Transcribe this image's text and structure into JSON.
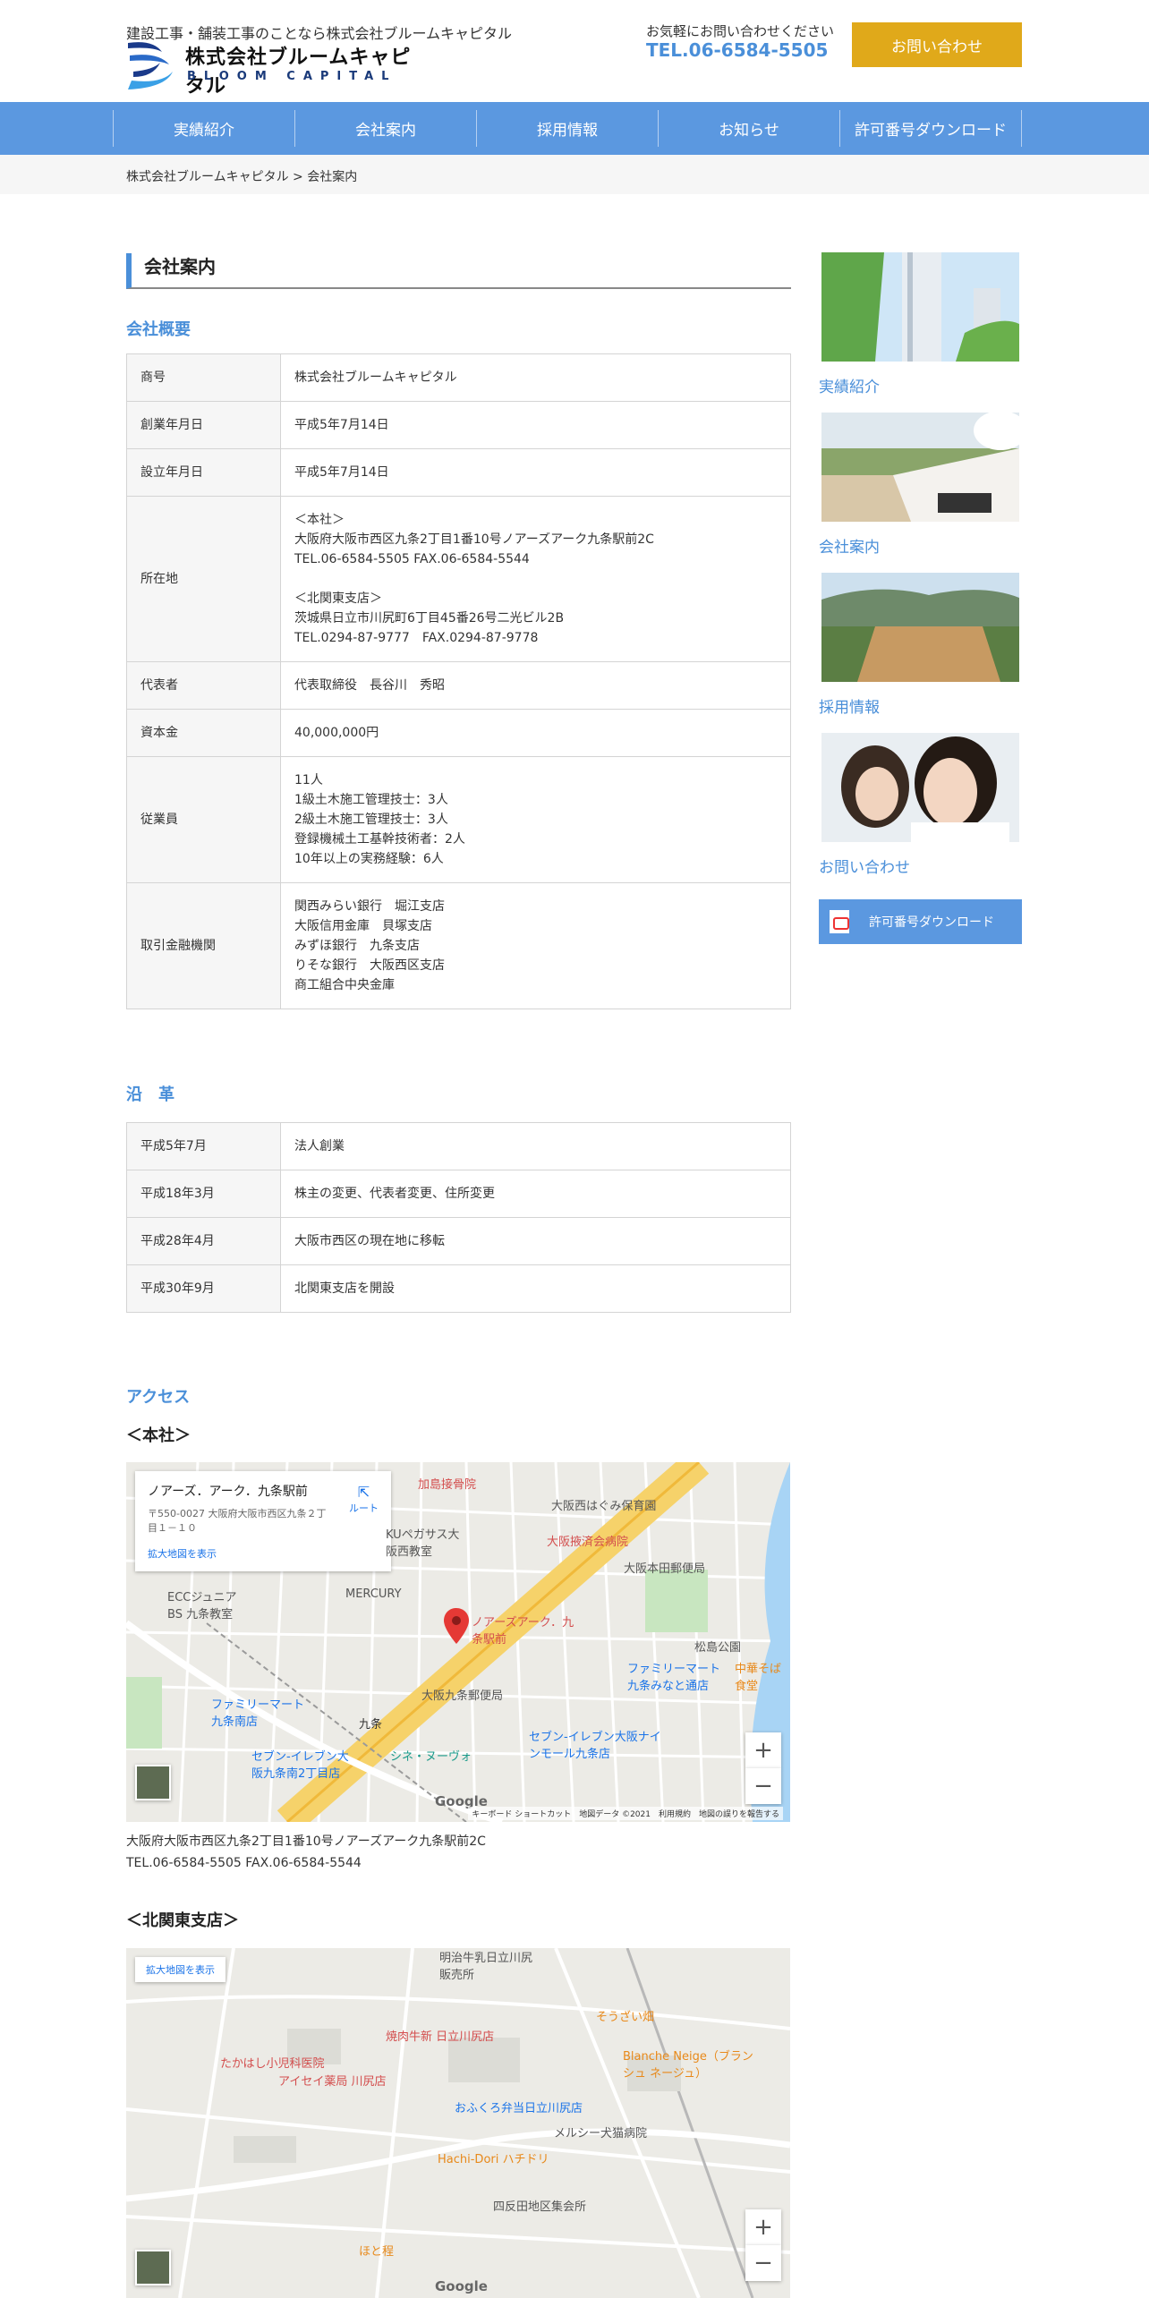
{
  "header": {
    "tagline": "建設工事・舗装工事のことなら株式会社ブルームキャピタル",
    "logo_name": "株式会社ブルームキャピタル",
    "logo_sub": "BLOOM CAPITAL",
    "contact_note": "お気軽にお問い合わせください",
    "tel": "TEL.06-6584-5505",
    "contact_button": "お問い合わせ"
  },
  "nav": {
    "items": [
      "実績紹介",
      "会社案内",
      "採用情報",
      "お知らせ",
      "許可番号ダウンロード"
    ]
  },
  "breadcrumb": "株式会社ブルームキャピタル > 会社案内",
  "page_title": "会社案内",
  "overview": {
    "title": "会社概要",
    "rows": [
      {
        "label": "商号",
        "value": "株式会社ブルームキャピタル"
      },
      {
        "label": "創業年月日",
        "value": "平成5年7月14日"
      },
      {
        "label": "設立年月日",
        "value": "平成5年7月14日"
      },
      {
        "label": "所在地",
        "value": "＜本社＞\n大阪府大阪市西区九条2丁目1番10号ノアーズアーク九条駅前2C\nTEL.06-6584-5505 FAX.06-6584-5544\n\n＜北関東支店＞\n茨城県日立市川尻町6丁目45番26号二光ビル2B\nTEL.0294-87-9777　FAX.0294-87-9778"
      },
      {
        "label": "代表者",
        "value": "代表取締役　長谷川　秀昭"
      },
      {
        "label": "資本金",
        "value": "40,000,000円"
      },
      {
        "label": "従業員",
        "value": "11人\n1級土木施工管理技士：3人\n2級土木施工管理技士：3人\n登録機械土工基幹技術者：2人\n10年以上の実務経験：6人"
      },
      {
        "label": "取引金融機関",
        "value": "関西みらい銀行　堀江支店\n大阪信用金庫　貝塚支店\nみずほ銀行　九条支店\nりそな銀行　大阪西区支店\n商工組合中央金庫"
      }
    ]
  },
  "history": {
    "title": "沿　革",
    "rows": [
      {
        "label": "平成5年7月",
        "value": "法人創業"
      },
      {
        "label": "平成18年3月",
        "value": "株主の変更、代表者変更、住所変更"
      },
      {
        "label": "平成28年4月",
        "value": "大阪市西区の現在地に移転"
      },
      {
        "label": "平成30年9月",
        "value": "北関東支店を開設"
      }
    ]
  },
  "access": {
    "title": "アクセス",
    "head_office_heading": "＜本社＞",
    "head_office_address": "大阪府大阪市西区九条2丁目1番10号ノアーズアーク九条駅前2C",
    "head_office_tel": "TEL.06-6584-5505 FAX.06-6584-5544",
    "branch_heading": "＜北関東支店＞"
  },
  "map1": {
    "card_title": "ノアーズ．アーク．九条駅前",
    "card_address": "〒550-0027 大阪府大阪市西区九条２丁目１－１０",
    "card_link": "拡大地図を表示",
    "card_route": "ルート",
    "footer": "キーボード ショートカット　地図データ ©2021　利用規約　地図の誤りを報告する",
    "google": "Google",
    "labels": [
      "加島接骨院",
      "大阪西はぐみ保育園",
      "KUペガサス大阪西教室",
      "大阪掖済会病院",
      "大阪本田郵便局",
      "ECCジュニアBS 九条教室",
      "MERCURY",
      "ノアーズアーク．九条駅前",
      "松島公園",
      "大阪九条郵便局",
      "ファミリーマート九条みなと通店",
      "ファミリーマート九条南店",
      "セブン-イレブン大阪ナインモール九条店",
      "九条",
      "シネ・ヌーヴォ",
      "セブン-イレブン大阪九条南2丁目店",
      "中華そば 食堂"
    ]
  },
  "map2": {
    "link": "拡大地図を表示",
    "google": "Google",
    "labels": [
      "明治牛乳日立川尻販売所",
      "そうざい畑",
      "焼肉牛新 日立川尻店",
      "たかはし小児科医院",
      "アイセイ薬局 川尻店",
      "Blanche Neige（ブランシュ ネージュ）",
      "おふくろ弁当日立川尻店",
      "メルシー犬猫病院",
      "Hachi-Dori ハチドリ",
      "四反田地区集会所",
      "ほと程"
    ]
  },
  "sidebar": {
    "items": [
      {
        "label": "実績紹介"
      },
      {
        "label": "会社案内"
      },
      {
        "label": "採用情報"
      },
      {
        "label": "お問い合わせ"
      }
    ],
    "download_label": "許可番号ダウンロード"
  }
}
